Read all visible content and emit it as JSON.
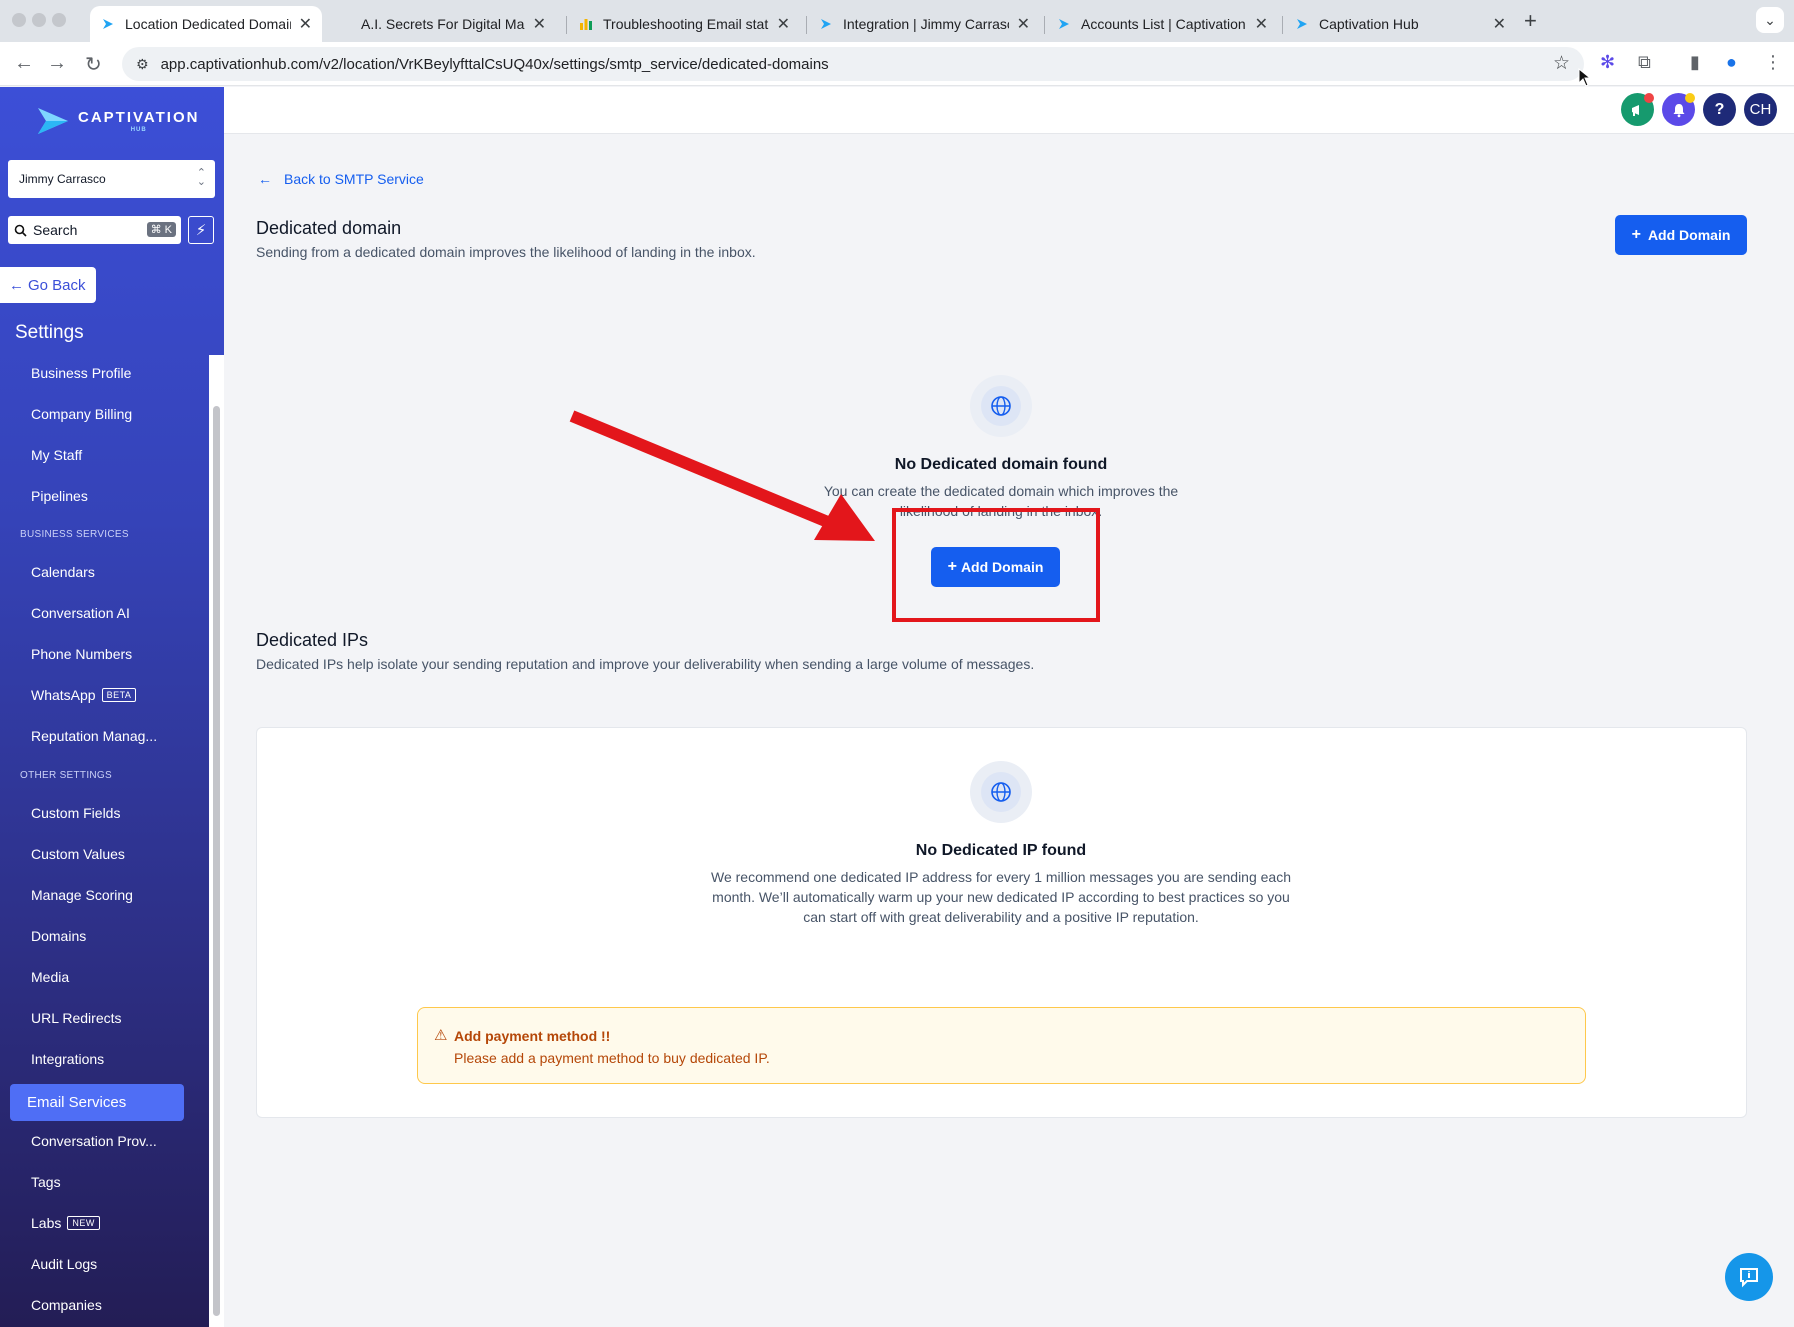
{
  "browser": {
    "tabs": [
      {
        "title": "Location Dedicated Domain |",
        "active": true
      },
      {
        "title": "A.I. Secrets For Digital Marke",
        "active": false
      },
      {
        "title": "Troubleshooting Email statist",
        "active": false
      },
      {
        "title": "Integration | Jimmy Carrasco",
        "active": false
      },
      {
        "title": "Accounts List | Captivation H",
        "active": false
      },
      {
        "title": "Captivation Hub",
        "active": false
      }
    ],
    "url": "app.captivationhub.com/v2/location/VrKBeylyfttalCsUQ40x/settings/smtp_service/dedicated-domains"
  },
  "sidebar": {
    "logo_text": "CAPTIVATION",
    "logo_sub": "HUB",
    "account": "Jimmy Carrasco",
    "search_placeholder": "Search",
    "search_shortcut": "⌘ K",
    "go_back": "Go Back",
    "settings_heading": "Settings",
    "items": [
      {
        "label": "Business Profile"
      },
      {
        "label": "Company Billing"
      },
      {
        "label": "My Staff"
      },
      {
        "label": "Pipelines"
      }
    ],
    "section_business": "BUSINESS SERVICES",
    "business_items": [
      {
        "label": "Calendars"
      },
      {
        "label": "Conversation AI"
      },
      {
        "label": "Phone Numbers"
      },
      {
        "label": "WhatsApp",
        "badge": "BETA"
      },
      {
        "label": "Reputation Manag..."
      }
    ],
    "section_other": "OTHER SETTINGS",
    "other_items": [
      {
        "label": "Custom Fields"
      },
      {
        "label": "Custom Values"
      },
      {
        "label": "Manage Scoring"
      },
      {
        "label": "Domains"
      },
      {
        "label": "Media"
      },
      {
        "label": "URL Redirects"
      },
      {
        "label": "Integrations"
      },
      {
        "label": "Email Services",
        "active": true
      },
      {
        "label": "Conversation Prov..."
      },
      {
        "label": "Tags"
      },
      {
        "label": "Labs",
        "badge": "NEW"
      },
      {
        "label": "Audit Logs"
      },
      {
        "label": "Companies"
      }
    ]
  },
  "topbar": {
    "help_label": "?",
    "avatar_initials": "CH"
  },
  "main": {
    "back_link": "Back to SMTP Service",
    "dedicated_domain": {
      "title": "Dedicated domain",
      "subtitle": "Sending from a dedicated domain improves the likelihood of landing in the inbox.",
      "add_button": "Add Domain",
      "empty_title": "No Dedicated domain found",
      "empty_text": "You can create the dedicated domain which improves the likelihood of landing in the inbox.",
      "empty_button": "Add Domain"
    },
    "dedicated_ips": {
      "title": "Dedicated IPs",
      "subtitle": "Dedicated IPs help isolate your sending reputation and improve your deliverability when sending a large volume of messages.",
      "empty_title": "No Dedicated IP found",
      "empty_text": "We recommend one dedicated IP address for every 1 million messages you are sending each month. We’ll automatically warm up your new dedicated IP according to best practices so you can start off with great deliverability and a positive IP reputation.",
      "alert_title": "Add payment method !!",
      "alert_text": "Please add a payment method to buy dedicated IP."
    }
  },
  "colors": {
    "accent": "#155eef",
    "sidebar_top": "#3c4fd7",
    "sidebar_bottom": "#231d55",
    "annotation_red": "#e3161b"
  }
}
